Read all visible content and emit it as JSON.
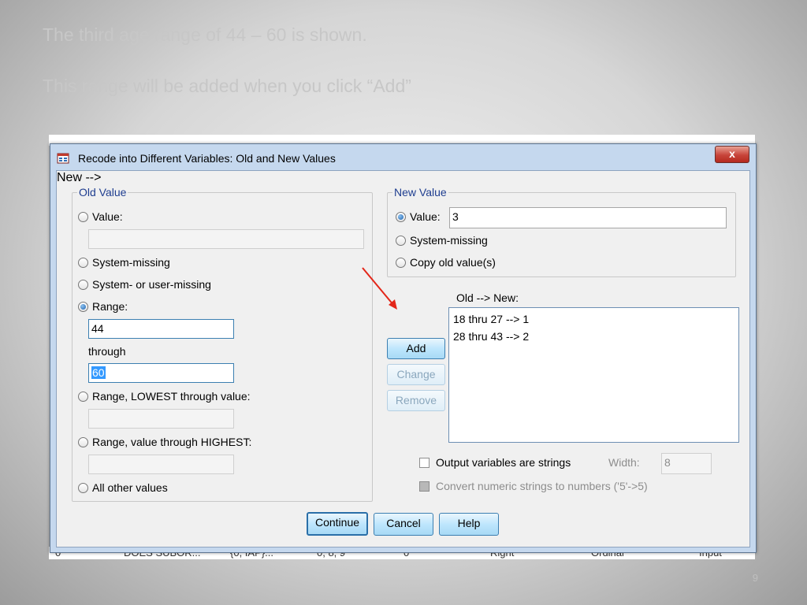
{
  "slide": {
    "caption_line1": "The third age range  of 44 – 60 is shown.",
    "caption_line2": "This range will be added when you click “Add”",
    "page_number": "9"
  },
  "background_table": {
    "bottom_row": [
      "0",
      "DOES SUBOR...",
      "{0, IAP}...",
      "0, 8, 9",
      "0",
      "Right",
      "Ordinal",
      "Input"
    ]
  },
  "dialog": {
    "title": "Recode into Different Variables: Old and New Values",
    "close_label": "x",
    "old_value": {
      "legend": "Old Value",
      "value_label": "Value:",
      "value_input": "",
      "system_missing_label": "System-missing",
      "system_or_user_missing_label": "System- or user-missing",
      "range_label": "Range:",
      "range_from": "44",
      "through_label": "through",
      "range_to": "60",
      "range_lowest_label": "Range, LOWEST through value:",
      "range_lowest_input": "",
      "range_highest_label": "Range, value through HIGHEST:",
      "range_highest_input": "",
      "all_other_label": "All other values",
      "selected": "Range"
    },
    "new_value": {
      "legend": "New Value",
      "value_label": "Value:",
      "value_input": "3",
      "system_missing_label": "System-missing",
      "copy_old_label": "Copy old value(s)",
      "selected": "Value"
    },
    "mapping": {
      "label": "Old --> New:",
      "items": [
        "18 thru 27 --> 1",
        "28 thru 43 --> 2"
      ]
    },
    "buttons": {
      "add": "Add",
      "change": "Change",
      "remove": "Remove",
      "continue": "Continue",
      "cancel": "Cancel",
      "help": "Help"
    },
    "output_strings_label": "Output variables are strings",
    "width_label": "Width:",
    "width_value": "8",
    "convert_label": "Convert numeric strings to numbers ('5'->5)"
  },
  "colors": {
    "accent": "#3399ff",
    "annotation_arrow": "#e32619"
  }
}
